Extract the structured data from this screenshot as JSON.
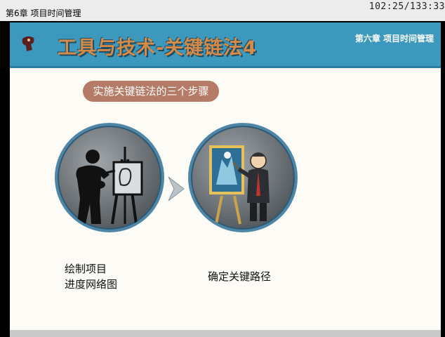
{
  "window": {
    "chapter_label": "第6章 项目时间管理",
    "timer": "102:25/133:33"
  },
  "banner": {
    "title": "工具与技术-关键链法4",
    "subtitle": "第六章 项目时间管理",
    "background_color": "#3d98bd",
    "title_color": "#d68a47"
  },
  "section": {
    "pill_label": "实施关键链法的三个步骤",
    "pill_color": "#b67b66"
  },
  "steps": [
    {
      "label_line1": "绘制项目",
      "label_line2": "进度网络图",
      "icon": "painter-icon"
    },
    {
      "label_line1": "确定关键路径",
      "icon": "painter-with-easel-icon"
    }
  ],
  "arrow_icon": "chevron-right-icon"
}
